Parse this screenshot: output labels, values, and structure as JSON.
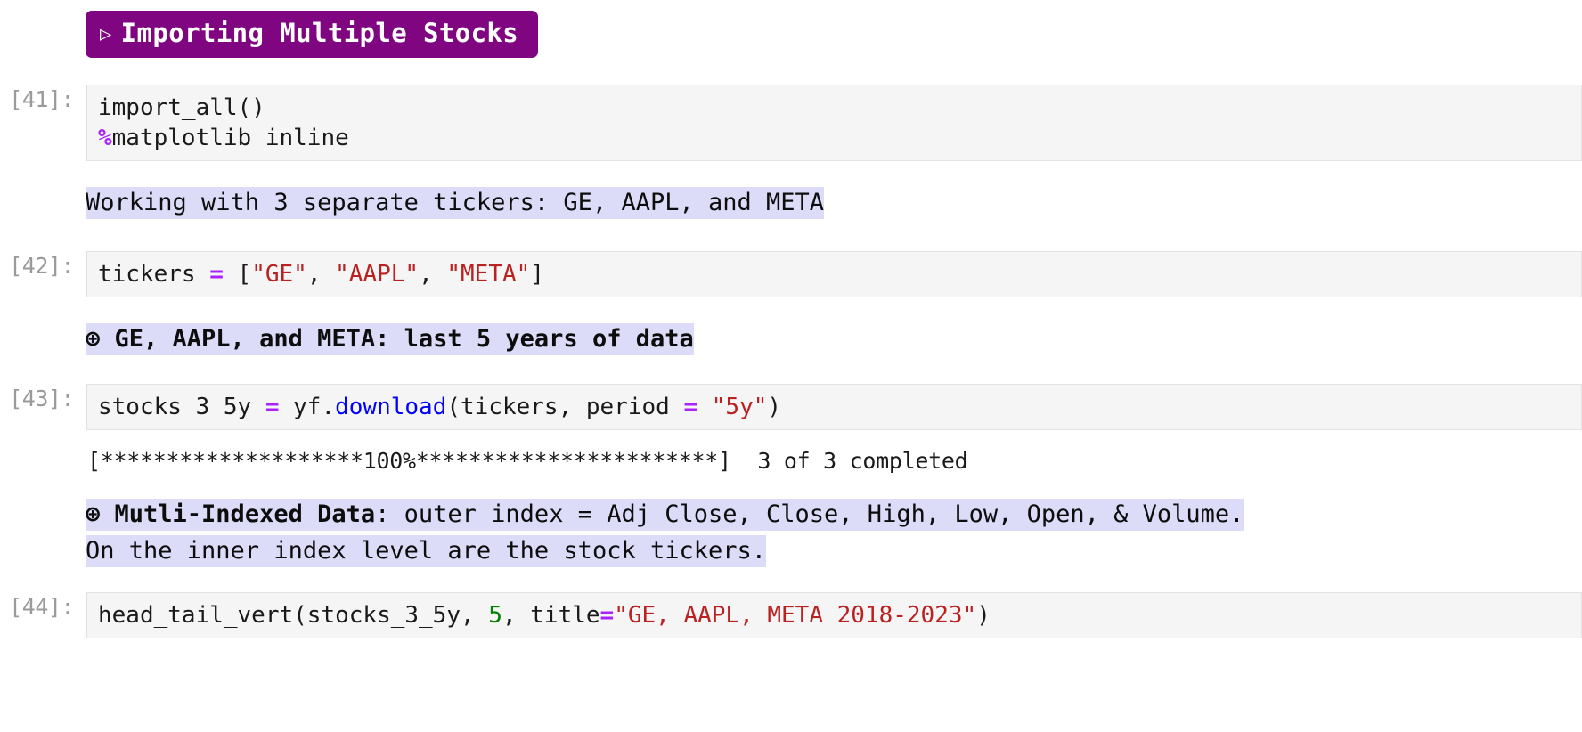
{
  "notebook": {
    "header": {
      "icon": "triangle-right-icon",
      "icon_glyph": "▷",
      "text": "Importing Multiple Stocks",
      "background_color": "#800580",
      "text_color": "#ffffff"
    },
    "highlight_color": "#dcdcf8",
    "cells": [
      {
        "type": "code",
        "prompt": "[41]:",
        "lines": [
          [
            {
              "text": "import_all()",
              "style": "plain"
            }
          ],
          [
            {
              "text": "%",
              "style": "magic"
            },
            {
              "text": "matplotlib inline",
              "style": "plain"
            }
          ]
        ]
      },
      {
        "type": "markdown",
        "segments": [
          {
            "text": "Working with 3 separate tickers: GE, AAPL, and META",
            "style": "highlight"
          }
        ]
      },
      {
        "type": "code",
        "prompt": "[42]:",
        "lines": [
          [
            {
              "text": "tickers ",
              "style": "plain"
            },
            {
              "text": "=",
              "style": "op"
            },
            {
              "text": " [",
              "style": "plain"
            },
            {
              "text": "\"GE\"",
              "style": "str"
            },
            {
              "text": ", ",
              "style": "plain"
            },
            {
              "text": "\"AAPL\"",
              "style": "str"
            },
            {
              "text": ", ",
              "style": "plain"
            },
            {
              "text": "\"META\"",
              "style": "str"
            },
            {
              "text": "]",
              "style": "plain"
            }
          ]
        ]
      },
      {
        "type": "markdown",
        "segments": [
          {
            "text": "⊕ ",
            "style": "highlight-bold"
          },
          {
            "text": "GE, AAPL, and META: last 5 years of data",
            "style": "highlight-bold"
          }
        ]
      },
      {
        "type": "code",
        "prompt": "[43]:",
        "lines": [
          [
            {
              "text": "stocks_3_5y ",
              "style": "plain"
            },
            {
              "text": "=",
              "style": "op"
            },
            {
              "text": " yf.",
              "style": "plain"
            },
            {
              "text": "download",
              "style": "fn"
            },
            {
              "text": "(tickers, period ",
              "style": "plain"
            },
            {
              "text": "=",
              "style": "op"
            },
            {
              "text": " ",
              "style": "plain"
            },
            {
              "text": "\"5y\"",
              "style": "str"
            },
            {
              "text": ")",
              "style": "plain"
            }
          ]
        ]
      },
      {
        "type": "stream",
        "text": "[********************100%***********************]  3 of 3 completed"
      },
      {
        "type": "markdown",
        "segments": [
          {
            "text": "⊕ ",
            "style": "highlight-bold"
          },
          {
            "text": "Mutli-Indexed Data",
            "style": "highlight-bold"
          },
          {
            "text": ": outer index = Adj Close, Close, High, Low, Open, & Volume.\nOn the inner index level are the stock tickers.",
            "style": "highlight"
          }
        ]
      },
      {
        "type": "code",
        "prompt": "[44]:",
        "lines": [
          [
            {
              "text": "head_tail_vert(stocks_3_5y, ",
              "style": "plain"
            },
            {
              "text": "5",
              "style": "num"
            },
            {
              "text": ", title",
              "style": "plain"
            },
            {
              "text": "=",
              "style": "op"
            },
            {
              "text": "\"GE, AAPL, META 2018-2023\"",
              "style": "str"
            },
            {
              "text": ")",
              "style": "plain"
            }
          ]
        ]
      }
    ]
  }
}
